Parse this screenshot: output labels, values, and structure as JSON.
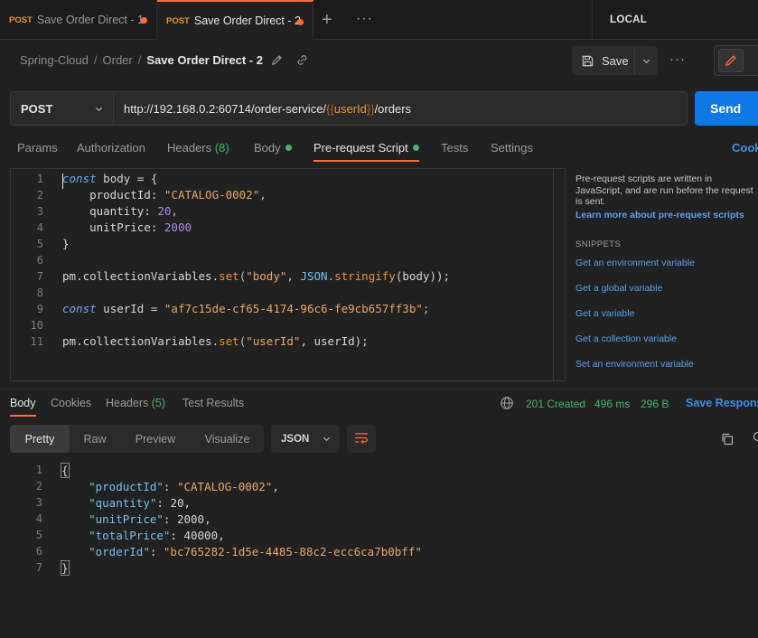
{
  "tabs": [
    {
      "method": "POST",
      "label": "Save Order Direct - 1"
    },
    {
      "method": "POST",
      "label": "Save Order Direct - 2"
    }
  ],
  "environment": "LOCAL",
  "breadcrumb": {
    "collection": "Spring-Cloud",
    "folder": "Order",
    "request": "Save Order Direct - 2"
  },
  "toolbar": {
    "save_label": "Save"
  },
  "request": {
    "method": "POST",
    "url_prefix": "http://192.168.0.2:60714/order-service/",
    "url_var_open": "{{",
    "url_var": "userId",
    "url_var_close": "}}",
    "url_suffix": "/orders",
    "send_label": "Send"
  },
  "request_tabs": {
    "params": "Params",
    "authorization": "Authorization",
    "headers": "Headers",
    "headers_count": "(8)",
    "body": "Body",
    "prerequest": "Pre-request Script",
    "tests": "Tests",
    "settings": "Settings",
    "cookies": "Cookies"
  },
  "script_lines": [
    "1",
    "2",
    "3",
    "4",
    "5",
    "6",
    "7",
    "8",
    "9",
    "10",
    "11"
  ],
  "script": {
    "l1a": "const",
    "l1b": " body = {",
    "l2a": "    productId: ",
    "l2b": "\"CATALOG-0002\"",
    "l2c": ",",
    "l3a": "    quantity: ",
    "l3b": "20",
    "l3c": ",",
    "l4a": "    unitPrice: ",
    "l4b": "2000",
    "l5": "}",
    "l7a": "pm",
    "l7b": ".collectionVariables.",
    "l7c": "set",
    "l7d": "(",
    "l7e": "\"body\"",
    "l7f": ", ",
    "l7g": "JSON",
    "l7h": ".",
    "l7i": "stringify",
    "l7j": "(body));",
    "l9a": "const",
    "l9b": " userId = ",
    "l9c": "\"af7c15de-cf65-4174-96c6-fe9cb657ff3b\"",
    "l9d": ";",
    "l11a": "pm",
    "l11b": ".collectionVariables.",
    "l11c": "set",
    "l11d": "(",
    "l11e": "\"userId\"",
    "l11f": ", userId);"
  },
  "help": {
    "text": "Pre-request scripts are written in JavaScript, and are run before the request is sent.",
    "learn_link": "Learn more about pre-request scripts",
    "snippets_title": "SNIPPETS",
    "snippets": [
      "Get an environment variable",
      "Get a global variable",
      "Get a variable",
      "Get a collection variable",
      "Set an environment variable"
    ]
  },
  "response_tabs": {
    "body": "Body",
    "cookies": "Cookies",
    "headers": "Headers",
    "headers_count": "(5)",
    "test_results": "Test Results"
  },
  "response_meta": {
    "status": "201 Created",
    "time": "496 ms",
    "size": "296 B",
    "save_response": "Save Response"
  },
  "view_modes": {
    "pretty": "Pretty",
    "raw": "Raw",
    "preview": "Preview",
    "visualize": "Visualize"
  },
  "format": "JSON",
  "response_lines": [
    "1",
    "2",
    "3",
    "4",
    "5",
    "6",
    "7"
  ],
  "response": {
    "open": "{",
    "k1": "\"productId\"",
    "v1": "\"CATALOG-0002\"",
    "k2": "\"quantity\"",
    "v2": "20",
    "k3": "\"unitPrice\"",
    "v3": "2000",
    "k4": "\"totalPrice\"",
    "v4": "40000",
    "k5": "\"orderId\"",
    "v5": "\"bc765282-1d5e-4485-88c2-ecc6ca7b0bff\"",
    "close": "}"
  },
  "colors": {
    "accent": "#ff6c37",
    "send": "#0f77e6",
    "success": "#49b36b",
    "link": "#3b8fe6"
  }
}
